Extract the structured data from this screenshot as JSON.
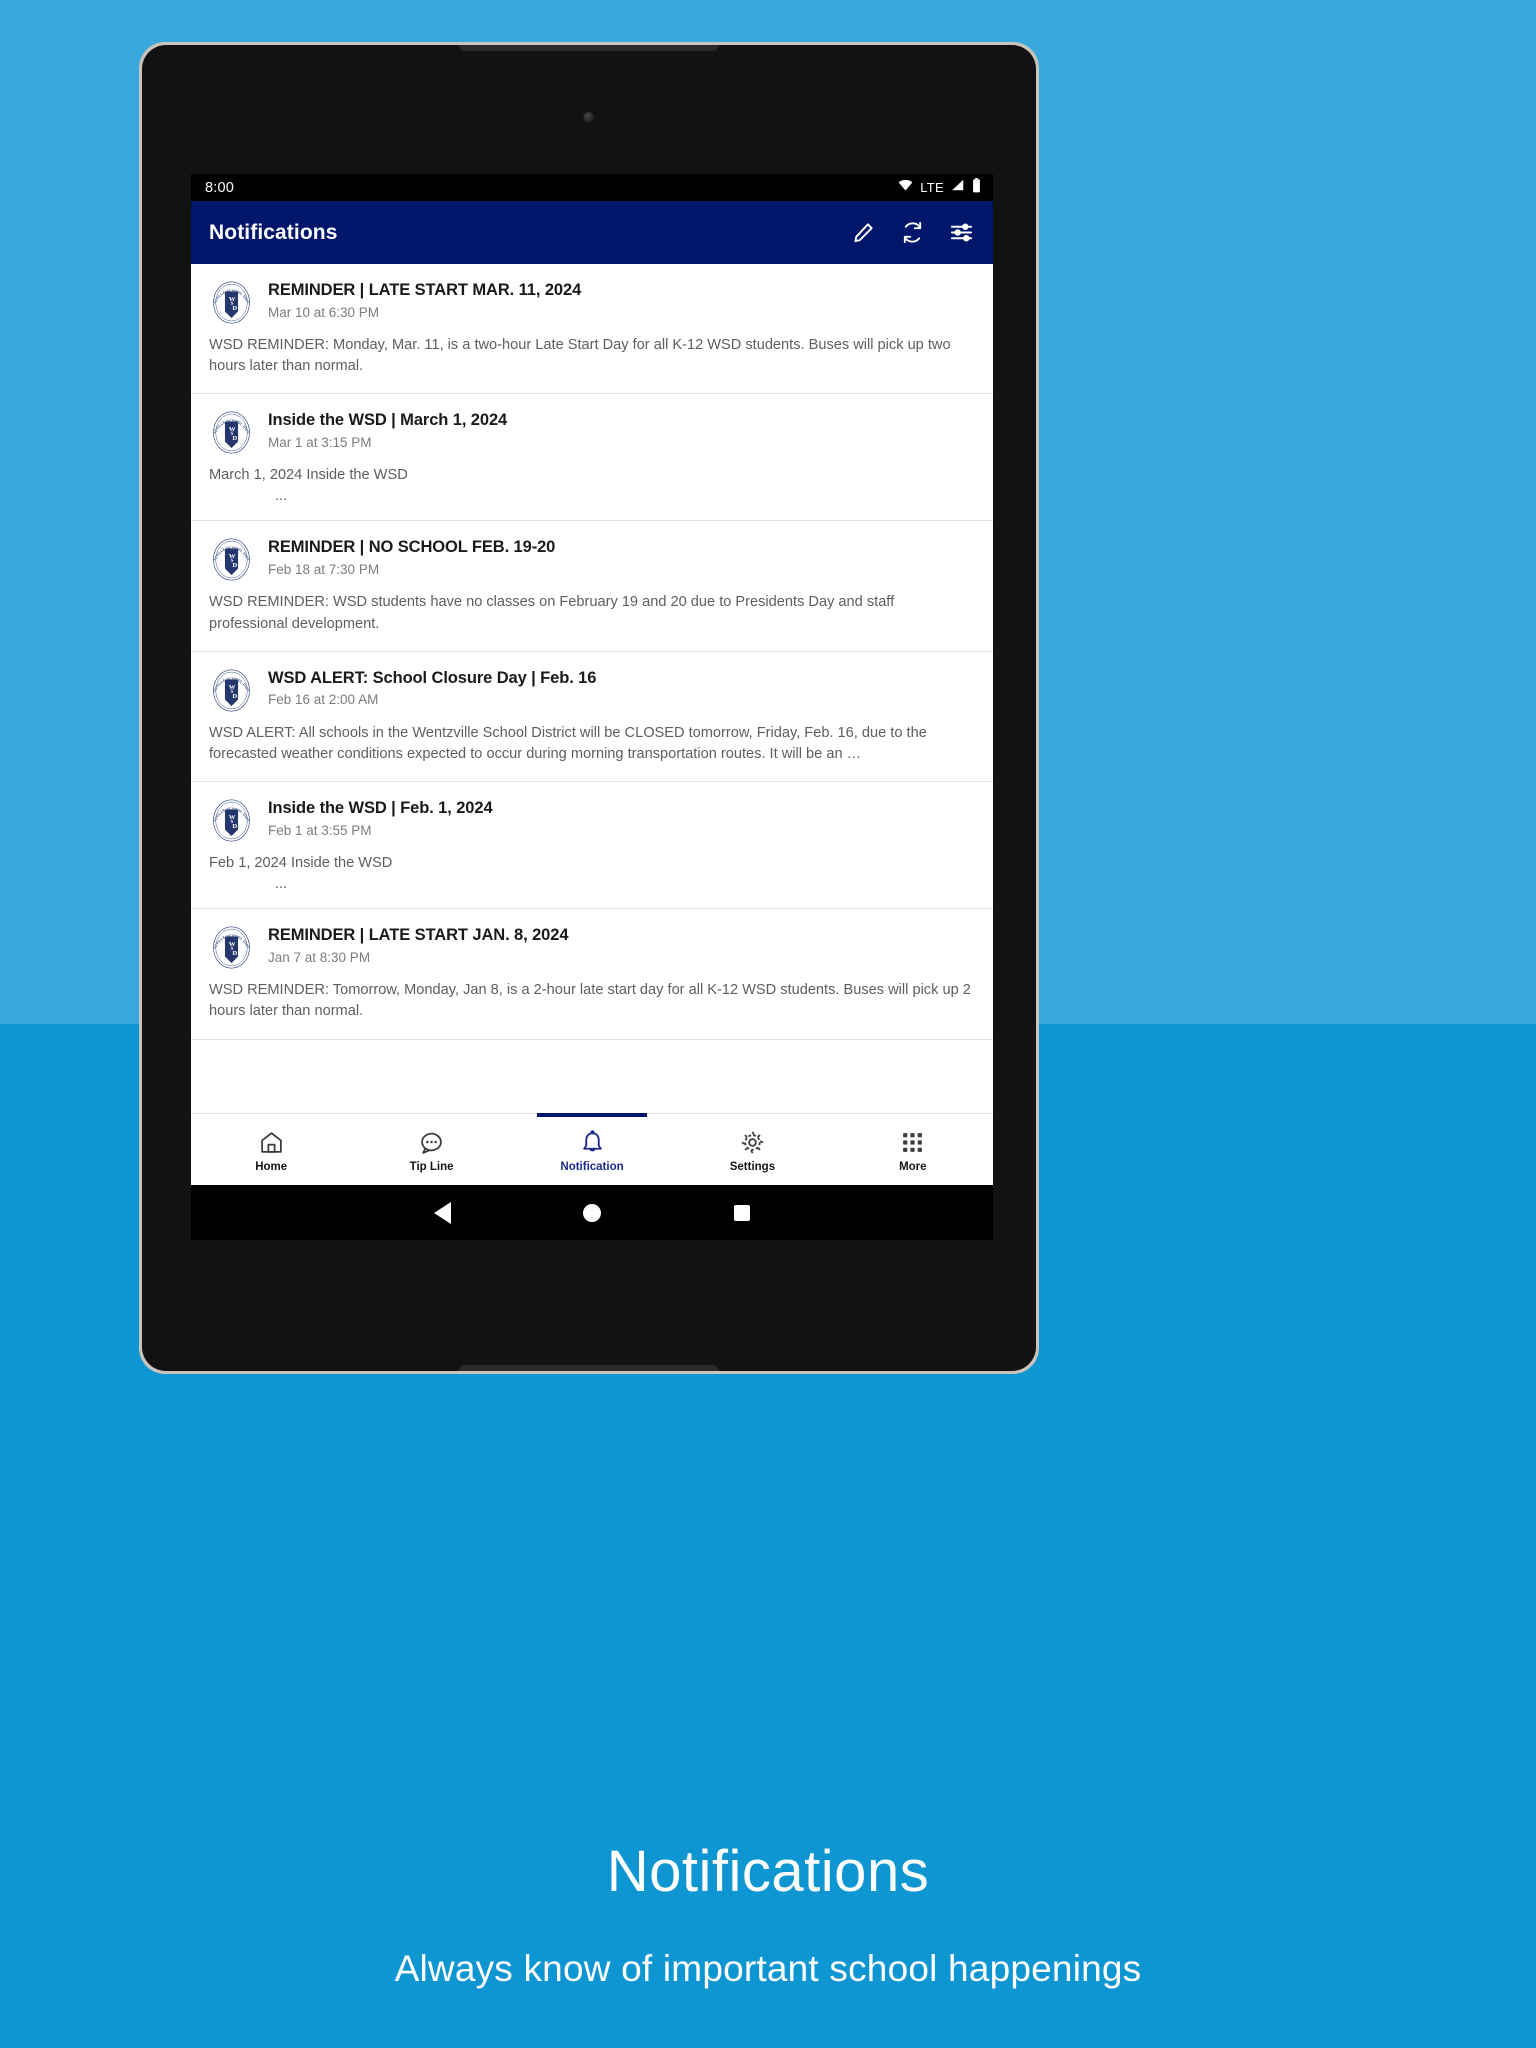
{
  "statusbar": {
    "time": "8:00",
    "wifi_icon": "wifi-icon",
    "network_label": "LTE",
    "signal_icon": "signal-icon",
    "battery_icon": "battery-icon"
  },
  "appbar": {
    "title": "Notifications",
    "actions": [
      {
        "name": "compose-icon",
        "label": "Compose"
      },
      {
        "name": "refresh-icon",
        "label": "Refresh"
      },
      {
        "name": "filter-icon",
        "label": "Filter"
      }
    ],
    "background_color": "#00166b"
  },
  "notifications": [
    {
      "logo": "wsd-district-logo",
      "title": "REMINDER | LATE START MAR. 11, 2024",
      "time": "Mar 10 at 6:30 PM",
      "body": "WSD REMINDER: Monday, Mar. 11, is a two-hour Late Start Day for all K-12 WSD students. Buses will pick up two hours later than normal.",
      "ellipsis": ""
    },
    {
      "logo": "wsd-district-logo",
      "title": "Inside the WSD | March 1, 2024",
      "time": "Mar 1 at 3:15 PM",
      "body": "March 1, 2024 Inside the WSD",
      "ellipsis": "..."
    },
    {
      "logo": "wsd-district-logo",
      "title": "REMINDER | NO SCHOOL FEB. 19-20",
      "time": "Feb 18 at 7:30 PM",
      "body": "WSD REMINDER: WSD students have no classes on February 19 and 20 due to Presidents Day and staff professional development.",
      "ellipsis": ""
    },
    {
      "logo": "wsd-district-logo",
      "title": "WSD ALERT: School Closure Day | Feb. 16",
      "time": "Feb 16 at 2:00 AM",
      "body": "WSD ALERT: All schools in the Wentzville School District will be CLOSED tomorrow, Friday, Feb. 16, due to the forecasted weather conditions expected to occur during morning transportation routes. It will be an …",
      "ellipsis": ""
    },
    {
      "logo": "wsd-district-logo",
      "title": "Inside the WSD | Feb. 1, 2024",
      "time": "Feb 1 at 3:55 PM",
      "body": "Feb 1, 2024 Inside the WSD",
      "ellipsis": "..."
    },
    {
      "logo": "wsd-district-logo",
      "title": "REMINDER | LATE START JAN. 8, 2024",
      "time": "Jan 7 at 8:30 PM",
      "body": "WSD REMINDER: Tomorrow, Monday, Jan 8, is a 2-hour late start day for all K-12 WSD students. Buses will pick up 2 hours later than normal.",
      "ellipsis": ""
    }
  ],
  "bottom_nav": {
    "items": [
      {
        "icon": "home-icon",
        "label": "Home",
        "active": false
      },
      {
        "icon": "tipline-icon",
        "label": "Tip Line",
        "active": false
      },
      {
        "icon": "notification-icon",
        "label": "Notification",
        "active": true
      },
      {
        "icon": "settings-icon",
        "label": "Settings",
        "active": false
      },
      {
        "icon": "more-grid-icon",
        "label": "More",
        "active": false
      }
    ],
    "active_color": "#1b2a8a"
  },
  "android_nav": {
    "back": "back-triangle-icon",
    "home": "home-circle-icon",
    "recents": "recents-square-icon"
  },
  "caption": {
    "title": "Notifications",
    "subtitle": "Always know of important school happenings"
  },
  "logo_text": {
    "arc": "WENTZVILLE SCHOOL DISTRICT",
    "monogram": "WSD"
  },
  "theme": {
    "background_top": "#38a9dd",
    "background_bottom": "#0d96d1",
    "brand_navy": "#00166b"
  }
}
